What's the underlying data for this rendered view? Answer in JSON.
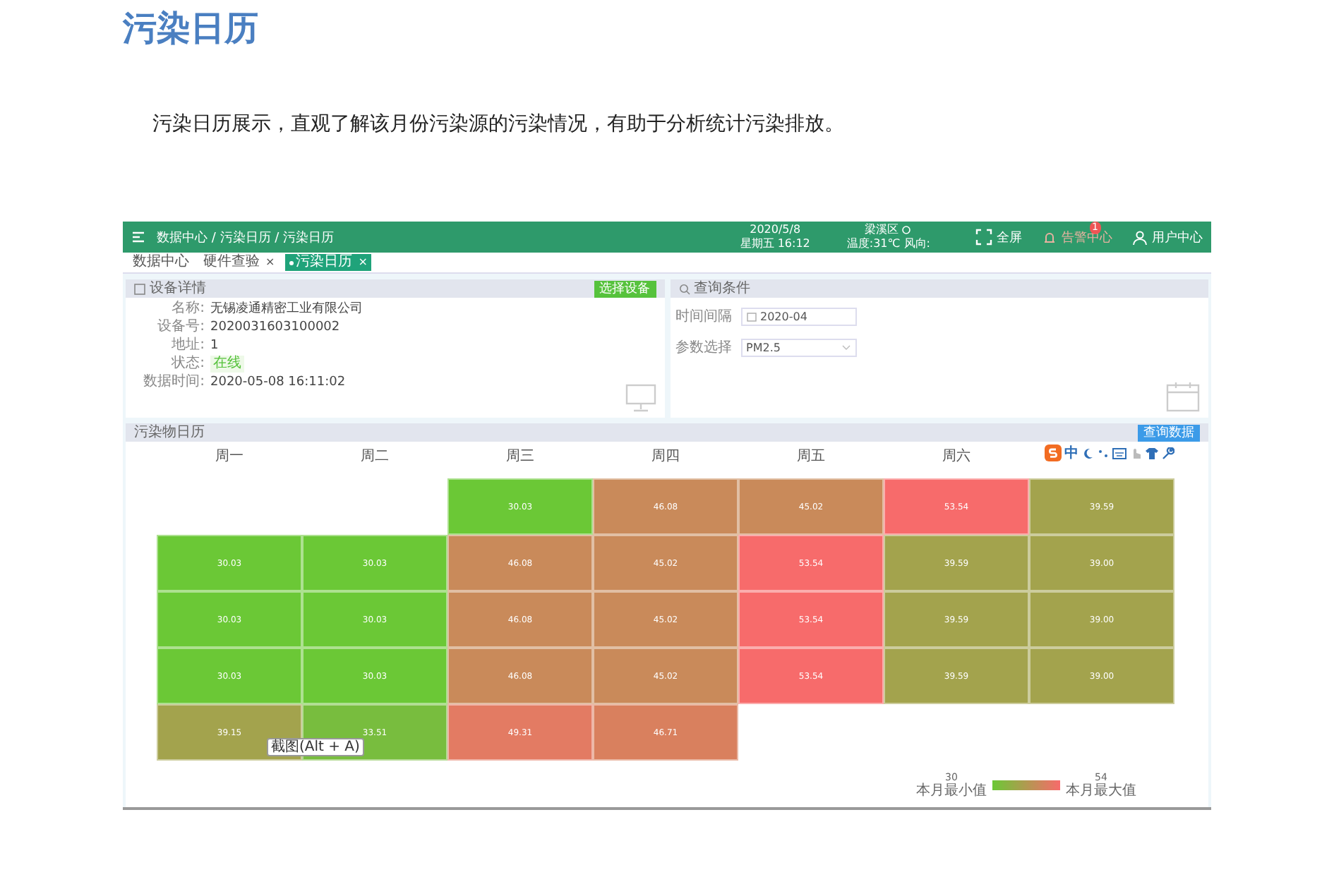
{
  "page_title": "污染日历",
  "intro": "污染日历展示，直观了解该月份污染源的污染情况，有助于分析统计污染排放。",
  "app": {
    "topbar": {
      "breadcrumb": "数据中心 / 污染日历 / 污染日历",
      "date": "2020/5/8",
      "weekday_time": "星期五 16:12",
      "district": "梁溪区",
      "weather": "温度:31℃ 风向:",
      "fullscreen": "全屏",
      "alert_label": "告警中心",
      "alert_badge": "1",
      "user": "用户中心"
    },
    "tabs": [
      {
        "label": "数据中心",
        "selected": false
      },
      {
        "label": "硬件查验",
        "selected": false,
        "close": "×"
      },
      {
        "label": "污染日历",
        "selected": true,
        "close": "×"
      }
    ],
    "device_panel": {
      "title": "设备详情",
      "button": "选择设备",
      "fields": [
        {
          "label": "名称:",
          "value": "无锡凌通精密工业有限公司",
          "kind": "text"
        },
        {
          "label": "设备号:",
          "value": "2020031603100002",
          "kind": "text"
        },
        {
          "label": "地址:",
          "value": "1",
          "kind": "text"
        },
        {
          "label": "状态:",
          "value": "在线",
          "kind": "badge"
        },
        {
          "label": "数据时间:",
          "value": "2020-05-08 16:11:02",
          "kind": "text"
        }
      ]
    },
    "query_panel": {
      "title": "查询条件",
      "fields": [
        {
          "label": "时间间隔",
          "value": "2020-04",
          "kind": "date"
        },
        {
          "label": "参数选择",
          "value": "PM2.5",
          "kind": "select"
        }
      ]
    },
    "calendar": {
      "title": "污染物日历",
      "button": "查询数据",
      "weekdays": [
        "周一",
        "周二",
        "周三",
        "周四",
        "周五",
        "周六"
      ],
      "rows": [
        [
          null,
          null,
          {
            "value": "30.03",
            "color": "#6bc836"
          },
          {
            "value": "46.08",
            "color": "#c98a5a"
          },
          {
            "value": "45.02",
            "color": "#c98a5a"
          },
          {
            "value": "53.54",
            "color": "#f76b6b"
          },
          {
            "value": "39.59",
            "color": "#a3a34d"
          }
        ],
        [
          {
            "value": "30.03",
            "color": "#6bc836"
          },
          {
            "value": "30.03",
            "color": "#6bc836"
          },
          {
            "value": "46.08",
            "color": "#c98a5a"
          },
          {
            "value": "45.02",
            "color": "#c98a5a"
          },
          {
            "value": "53.54",
            "color": "#f76b6b"
          },
          {
            "value": "39.59",
            "color": "#a3a34d"
          },
          {
            "value": "39.00",
            "color": "#a3a34d"
          }
        ],
        [
          {
            "value": "30.03",
            "color": "#6bc836"
          },
          {
            "value": "30.03",
            "color": "#6bc836"
          },
          {
            "value": "46.08",
            "color": "#c98a5a"
          },
          {
            "value": "45.02",
            "color": "#c98a5a"
          },
          {
            "value": "53.54",
            "color": "#f76b6b"
          },
          {
            "value": "39.59",
            "color": "#a3a34d"
          },
          {
            "value": "39.00",
            "color": "#a3a34d"
          }
        ],
        [
          {
            "value": "30.03",
            "color": "#6bc836"
          },
          {
            "value": "30.03",
            "color": "#6bc836"
          },
          {
            "value": "46.08",
            "color": "#c98a5a"
          },
          {
            "value": "45.02",
            "color": "#c98a5a"
          },
          {
            "value": "53.54",
            "color": "#f76b6b"
          },
          {
            "value": "39.59",
            "color": "#a3a34d"
          },
          {
            "value": "39.00",
            "color": "#a3a34d"
          }
        ],
        [
          {
            "value": "39.15",
            "color": "#a3a34d"
          },
          {
            "value": "33.51",
            "color": "#78bd3e"
          },
          {
            "value": "49.31",
            "color": "#e37b63"
          },
          {
            "value": "46.71",
            "color": "#d9805e"
          },
          null,
          null,
          null
        ]
      ],
      "legend": {
        "min": "30",
        "min_label": "本月最小值",
        "max": "54",
        "max_label": "本月最大值"
      }
    },
    "ime_mode": "中",
    "tooltip": "截图(Alt + A)"
  }
}
